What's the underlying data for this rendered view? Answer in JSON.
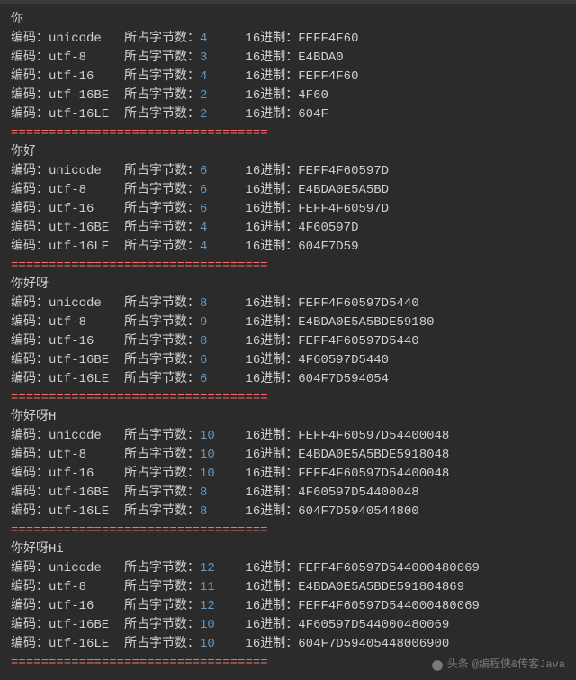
{
  "labels": {
    "encoding": "编码：",
    "bytes": "所占字节数：",
    "hex": "16进制：",
    "separator": "=================================="
  },
  "watermark": {
    "prefix": "头条",
    "author": "@编程侠&传客Java"
  },
  "blocks": [
    {
      "title": "你",
      "rows": [
        {
          "enc": "unicode",
          "bytes": "4",
          "hex": "FEFF4F60"
        },
        {
          "enc": "utf-8",
          "bytes": "3",
          "hex": "E4BDA0"
        },
        {
          "enc": "utf-16",
          "bytes": "4",
          "hex": "FEFF4F60"
        },
        {
          "enc": "utf-16BE",
          "bytes": "2",
          "hex": "4F60"
        },
        {
          "enc": "utf-16LE",
          "bytes": "2",
          "hex": "604F"
        }
      ]
    },
    {
      "title": "你好",
      "rows": [
        {
          "enc": "unicode",
          "bytes": "6",
          "hex": "FEFF4F60597D"
        },
        {
          "enc": "utf-8",
          "bytes": "6",
          "hex": "E4BDA0E5A5BD"
        },
        {
          "enc": "utf-16",
          "bytes": "6",
          "hex": "FEFF4F60597D"
        },
        {
          "enc": "utf-16BE",
          "bytes": "4",
          "hex": "4F60597D"
        },
        {
          "enc": "utf-16LE",
          "bytes": "4",
          "hex": "604F7D59"
        }
      ]
    },
    {
      "title": "你好呀",
      "rows": [
        {
          "enc": "unicode",
          "bytes": "8",
          "hex": "FEFF4F60597D5440"
        },
        {
          "enc": "utf-8",
          "bytes": "9",
          "hex": "E4BDA0E5A5BDE59180"
        },
        {
          "enc": "utf-16",
          "bytes": "8",
          "hex": "FEFF4F60597D5440"
        },
        {
          "enc": "utf-16BE",
          "bytes": "6",
          "hex": "4F60597D5440"
        },
        {
          "enc": "utf-16LE",
          "bytes": "6",
          "hex": "604F7D594054"
        }
      ]
    },
    {
      "title": "你好呀H",
      "rows": [
        {
          "enc": "unicode",
          "bytes": "10",
          "hex": "FEFF4F60597D54400048"
        },
        {
          "enc": "utf-8",
          "bytes": "10",
          "hex": "E4BDA0E5A5BDE5918048"
        },
        {
          "enc": "utf-16",
          "bytes": "10",
          "hex": "FEFF4F60597D54400048"
        },
        {
          "enc": "utf-16BE",
          "bytes": "8",
          "hex": "4F60597D54400048"
        },
        {
          "enc": "utf-16LE",
          "bytes": "8",
          "hex": "604F7D5940544800"
        }
      ]
    },
    {
      "title": "你好呀Hi",
      "rows": [
        {
          "enc": "unicode",
          "bytes": "12",
          "hex": "FEFF4F60597D544000480069"
        },
        {
          "enc": "utf-8",
          "bytes": "11",
          "hex": "E4BDA0E5A5BDE591804869"
        },
        {
          "enc": "utf-16",
          "bytes": "12",
          "hex": "FEFF4F60597D544000480069"
        },
        {
          "enc": "utf-16BE",
          "bytes": "10",
          "hex": "4F60597D544000480069"
        },
        {
          "enc": "utf-16LE",
          "bytes": "10",
          "hex": "604F7D59405448006900"
        }
      ]
    }
  ]
}
